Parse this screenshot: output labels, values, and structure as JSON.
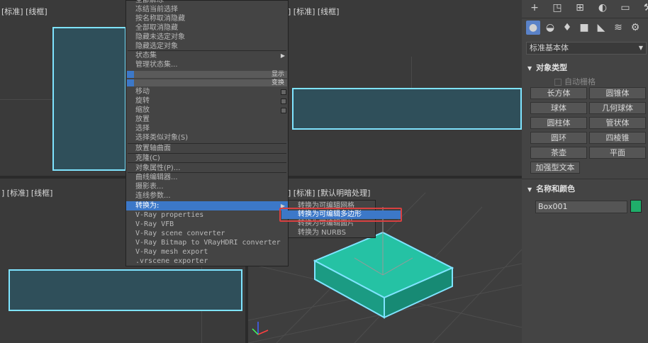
{
  "viewports": {
    "top_left_label": "[标准] [线框]",
    "top_right_label": "] [标准] [线框]",
    "bottom_left_label": "] [标准] [线框]",
    "bottom_right_label": "] [标准] [默认明暗处理]"
  },
  "context_menu": {
    "items_top": [
      "全部解冻",
      "冻结当前选择",
      "按名称取消隐藏",
      "全部取消隐藏",
      "隐藏未选定对象",
      "隐藏选定对象"
    ],
    "state_set": "状态集",
    "manage_state_set": "管理状态集...",
    "band_display": "显示",
    "band_transform": "变换",
    "transform_items": [
      "移动",
      "旋转",
      "缩放",
      "放置",
      "选择",
      "选择类似对象(S)"
    ],
    "place_pivot": "放置轴曲面",
    "clone": "克隆(C)",
    "object_properties": "对象属性(P)...",
    "curve_editor": "曲线编辑器...",
    "dope_sheet": "摄影表...",
    "wire_params": "连线参数...",
    "convert_to": "转换为:",
    "vray_items": [
      "V-Ray properties",
      "V-Ray VFB",
      "V-Ray scene converter",
      "V-Ray Bitmap to VRayHDRI converter",
      "V-Ray mesh export",
      ".vrscene exporter"
    ]
  },
  "submenu": {
    "items": [
      "转换为可编辑网格",
      "转换为可编辑多边形",
      "转换为可编辑面片",
      "转换为 NURBS"
    ],
    "highlighted_index": 1
  },
  "panel": {
    "toolbar_icons": [
      "plus-icon",
      "modify-icon",
      "hierarchy-icon",
      "motion-icon",
      "display-icon",
      "utilities-icon"
    ],
    "category_icons": [
      "sphere-icon",
      "shapes-icon",
      "light-icon",
      "camera-icon",
      "helper-icon",
      "spacewarp-icon",
      "systems-icon"
    ],
    "dropdown_value": "标准基本体",
    "object_type_title": "对象类型",
    "auto_grid": "自动栅格",
    "buttons": [
      "长方体",
      "圆锥体",
      "球体",
      "几何球体",
      "圆柱体",
      "管状体",
      "圆环",
      "四棱锥",
      "茶壶",
      "平面",
      "加强型文本"
    ],
    "name_color_title": "名称和颜色",
    "object_name": "Box001",
    "object_color": "#1fae6a"
  },
  "colors": {
    "highlight": "#3c78c8",
    "selection_outline": "#7fe4ff",
    "annotation_box": "#d84040",
    "box_fill": "#22b59a"
  }
}
